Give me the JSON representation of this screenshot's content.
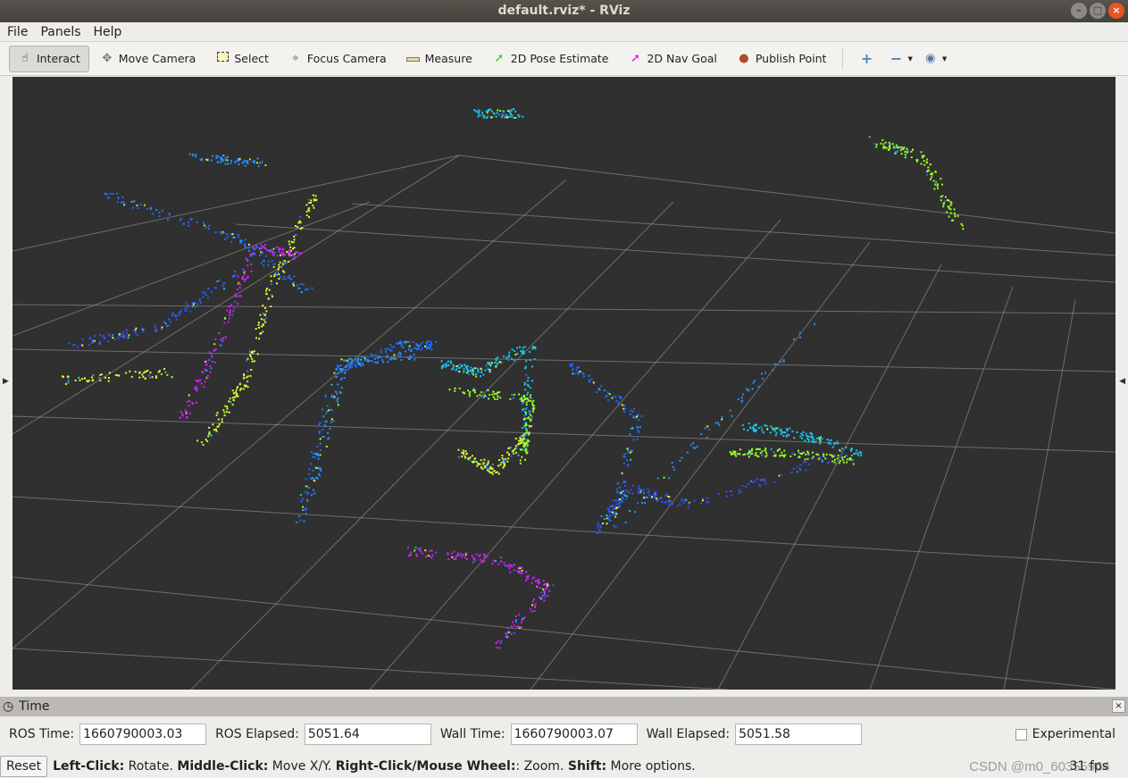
{
  "window": {
    "title": "default.rviz* - RViz"
  },
  "menu": [
    "File",
    "Panels",
    "Help"
  ],
  "toolbar": {
    "tools": [
      {
        "label": "Interact",
        "icon": "hand-icon",
        "active": true
      },
      {
        "label": "Move Camera",
        "icon": "move-camera-icon"
      },
      {
        "label": "Select",
        "icon": "select-icon"
      },
      {
        "label": "Focus Camera",
        "icon": "focus-camera-icon"
      },
      {
        "label": "Measure",
        "icon": "ruler-icon"
      },
      {
        "label": "2D Pose Estimate",
        "icon": "green-arrow-icon"
      },
      {
        "label": "2D Nav Goal",
        "icon": "magenta-arrow-icon"
      },
      {
        "label": "Publish Point",
        "icon": "map-pin-icon"
      }
    ]
  },
  "time_panel": {
    "title": "Time",
    "ros_time_label": "ROS Time:",
    "ros_time": "1660790003.03",
    "ros_elapsed_label": "ROS Elapsed:",
    "ros_elapsed": "5051.64",
    "wall_time_label": "Wall Time:",
    "wall_time": "1660790003.07",
    "wall_elapsed_label": "Wall Elapsed:",
    "wall_elapsed": "5051.58",
    "experimental_label": "Experimental",
    "experimental_checked": false
  },
  "status": {
    "reset_label": "Reset",
    "hint": [
      [
        "Left-Click:",
        " Rotate. "
      ],
      [
        "Middle-Click:",
        " Move X/Y. "
      ],
      [
        "Right-Click/Mouse Wheel:",
        ": Zoom. "
      ],
      [
        "Shift:",
        " More options."
      ]
    ],
    "fps": "31 fps"
  },
  "watermark": "CSDN @m0_60355964",
  "colors": {
    "viewport_bg": "#303030",
    "grid": "#a0a0a0"
  }
}
